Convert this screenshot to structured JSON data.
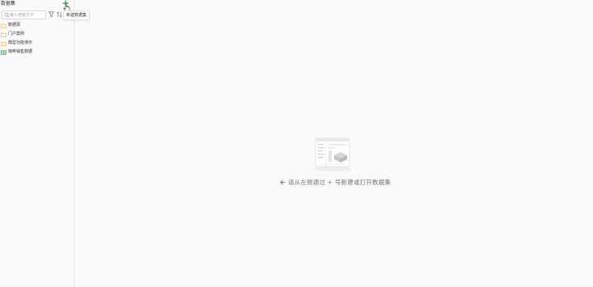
{
  "sidebar": {
    "title": "数据集",
    "add_tooltip": "新建数据集",
    "search": {
      "placeholder": "输入搜索文字",
      "value": ""
    },
    "items": [
      {
        "label": "数据源",
        "icon": "folder-icon"
      },
      {
        "label": "门户案例",
        "icon": "folder-icon"
      },
      {
        "label": "典型功能演示",
        "icon": "folder-icon"
      },
      {
        "label": "咖啡销售数据",
        "icon": "table-icon"
      }
    ]
  },
  "main": {
    "empty_hint": "请从左侧通过 + 号新建或打开数据集"
  },
  "colors": {
    "add_accent": "#2e9e4f",
    "folder": "#f0b24a",
    "table": "#3fa55a",
    "border": "#e6e6e6"
  }
}
